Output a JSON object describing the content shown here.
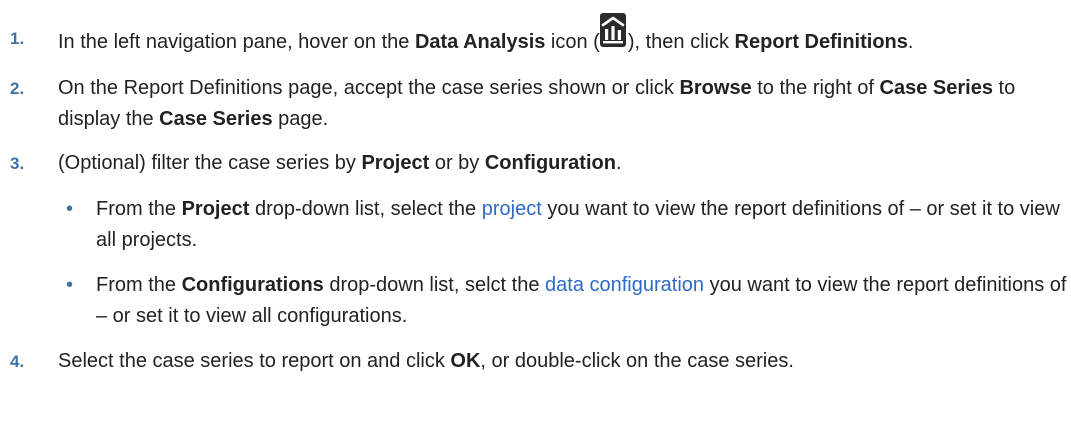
{
  "steps": [
    {
      "number": "1.",
      "pre": "In the left navigation pane, hover on the ",
      "bold1": "Data Analysis",
      "mid1": " icon (",
      "icon": "data-analysis-icon",
      "mid2": "), then click ",
      "bold2": "Report Definitions",
      "post": "."
    },
    {
      "number": "2.",
      "pre": "On the Report Definitions page, accept the case series shown or click ",
      "bold1": "Browse",
      "mid1": " to the right of ",
      "bold2": "Case Series",
      "mid2": " to display the ",
      "bold3": "Case Series",
      "post": " page."
    },
    {
      "number": "3.",
      "pre": "(Optional) filter the case series by ",
      "bold1": "Project",
      "mid1": " or by ",
      "bold2": "Configuration",
      "post": ".",
      "bullets": [
        {
          "pre": "From the ",
          "bold": "Project",
          "mid": " drop-down list, select the ",
          "link": "project",
          "post": " you want to view the report definitions of – or set it to view all projects."
        },
        {
          "pre": "From the ",
          "bold": "Configurations",
          "mid": " drop-down list, selct the ",
          "link": "data configuration",
          "post": " you want to view the report definitions of – or set it to view all configurations."
        }
      ]
    },
    {
      "number": "4.",
      "pre": "Select the case series to report on and click ",
      "bold1": "OK",
      "post": ", or double-click on the case series."
    }
  ],
  "bullet_glyph": "•",
  "colors": {
    "number": "#4272a3",
    "link": "#2e6ac8",
    "text": "#222222"
  }
}
